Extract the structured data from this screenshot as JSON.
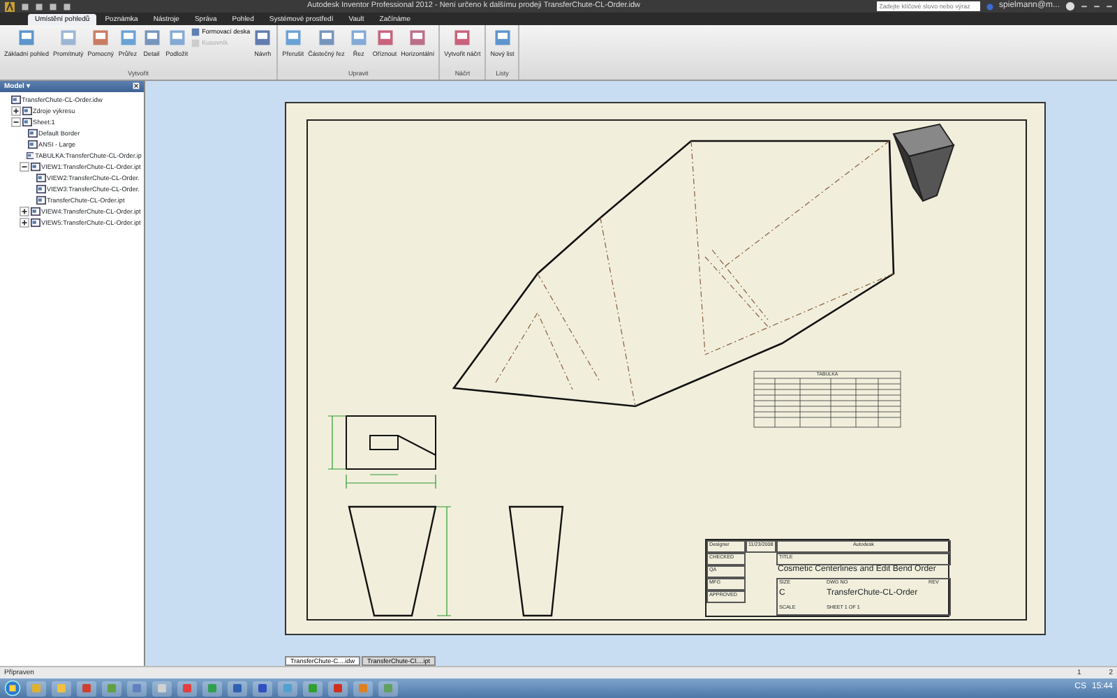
{
  "window": {
    "title": "Autodesk Inventor Professional 2012 - Není určeno k dalšímu prodeji    TransferChute-CL-Order.idw",
    "search": {
      "placeholder": "Zadejte klíčové slovo nebo výraz"
    },
    "user": "spielmann@m..."
  },
  "tabs": [
    {
      "label": "Umístění pohledů",
      "selected": true
    },
    {
      "label": "Poznámka",
      "selected": false
    },
    {
      "label": "Nástroje",
      "selected": false
    },
    {
      "label": "Správa",
      "selected": false
    },
    {
      "label": "Pohled",
      "selected": false
    },
    {
      "label": "Systémové prostředí",
      "selected": false
    },
    {
      "label": "Vault",
      "selected": false
    },
    {
      "label": "Začínáme",
      "selected": false
    }
  ],
  "ribbon_groups": [
    {
      "label": "Vytvořit",
      "tools": [
        {
          "kind": "large",
          "label": "Základní pohled",
          "disabled": false
        },
        {
          "kind": "large",
          "label": "Promítnutý",
          "disabled": false
        },
        {
          "kind": "large",
          "label": "Pomocný",
          "disabled": false
        },
        {
          "kind": "large",
          "label": "Průřez",
          "disabled": false
        },
        {
          "kind": "large",
          "label": "Detail",
          "disabled": false
        },
        {
          "kind": "large",
          "label": "Podložit",
          "disabled": false
        },
        {
          "kind": "small",
          "label": "Formovací deska",
          "disabled": false
        },
        {
          "kind": "small",
          "label": "Kusovník",
          "disabled": true
        },
        {
          "kind": "large",
          "label": "Návrh",
          "disabled": false
        }
      ]
    },
    {
      "label": "Upravit",
      "tools": [
        {
          "kind": "large",
          "label": "Přerušit",
          "disabled": false
        },
        {
          "kind": "large",
          "label": "Částečný řez",
          "disabled": false
        },
        {
          "kind": "large",
          "label": "Řez",
          "disabled": false
        },
        {
          "kind": "large",
          "label": "Oříznout",
          "disabled": false
        },
        {
          "kind": "large",
          "label": "Horizontální",
          "disabled": false
        }
      ]
    },
    {
      "label": "Náčrt",
      "tools": [
        {
          "kind": "large",
          "label": "Vytvořit náčrt",
          "disabled": false
        }
      ]
    },
    {
      "label": "Listy",
      "tools": [
        {
          "kind": "large",
          "label": "Nový list",
          "disabled": false
        }
      ]
    }
  ],
  "browser": {
    "title": "Model ▾",
    "tree": [
      {
        "label": "TransferChute-CL-Order.idw",
        "children": [
          {
            "label": "Zdroje výkresu",
            "expanded": false
          },
          {
            "label": "Sheet:1",
            "expanded": true,
            "children": [
              {
                "label": "Default Border"
              },
              {
                "label": "ANSI - Large"
              },
              {
                "label": "TABULKA:TransferChute-CL-Order.ip"
              },
              {
                "label": "VIEW1:TransferChute-CL-Order.ipt",
                "expanded": true,
                "children": [
                  {
                    "label": "VIEW2:TransferChute-CL-Order."
                  },
                  {
                    "label": "VIEW3:TransferChute-CL-Order."
                  },
                  {
                    "label": "TransferChute-CL-Order.ipt"
                  }
                ]
              },
              {
                "label": "VIEW4:TransferChute-CL-Order.ipt",
                "expanded": false
              },
              {
                "label": "VIEW5:TransferChute-CL-Order.ipt",
                "expanded": false
              }
            ]
          }
        ]
      }
    ]
  },
  "sheet": {
    "table": {
      "title": "TABULKA"
    },
    "title_block": {
      "designer_label": "Designer",
      "date": "11/23/2008",
      "checked_label": "CHECKED",
      "qa_label": "QA",
      "mfg_label": "MFG",
      "approved_label": "APPROVED",
      "company": "Autodesk",
      "title_label": "TITLE",
      "title": "Cosmetic Centerlines and Edit Bend Order",
      "size_label": "SIZE",
      "size": "C",
      "dwg_label": "DWG NO",
      "dwg": "TransferChute-CL-Order",
      "rev_label": "REV",
      "scale_label": "SCALE",
      "sheet": "SHEET 1 OF 1"
    }
  },
  "document_tabs": [
    {
      "label": "TransferChute-C....idw",
      "selected": true
    },
    {
      "label": "TransferChute-Cl....ipt",
      "selected": false
    }
  ],
  "status_bar": {
    "text": "Připraven",
    "values": [
      "1",
      "2"
    ]
  },
  "taskbar": {
    "language": "CS",
    "clock": "15:44"
  }
}
